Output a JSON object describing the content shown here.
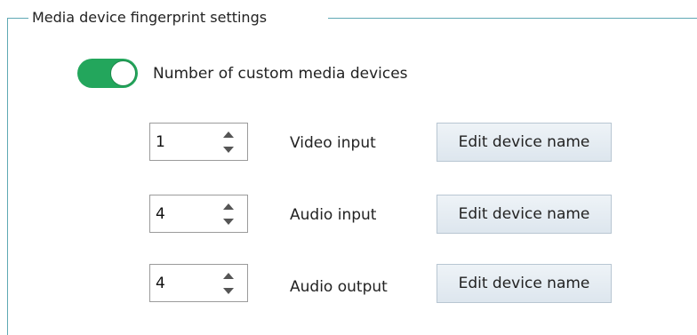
{
  "group": {
    "title": "Media device fingerprint settings"
  },
  "toggle": {
    "label": "Number of custom media devices",
    "state": "on",
    "color": "#23a65c"
  },
  "rows": [
    {
      "value": "1",
      "label": "Video input",
      "button": "Edit device name"
    },
    {
      "value": "4",
      "label": "Audio input",
      "button": "Edit device name"
    },
    {
      "value": "4",
      "label": "Audio output",
      "button": "Edit device name"
    }
  ],
  "icons": {
    "spin_up": "chevron-up-icon",
    "spin_down": "chevron-down-icon"
  },
  "colors": {
    "frame": "#5fa9b4",
    "toggle_on": "#23a65c",
    "button_bg": "#e6edf3"
  }
}
